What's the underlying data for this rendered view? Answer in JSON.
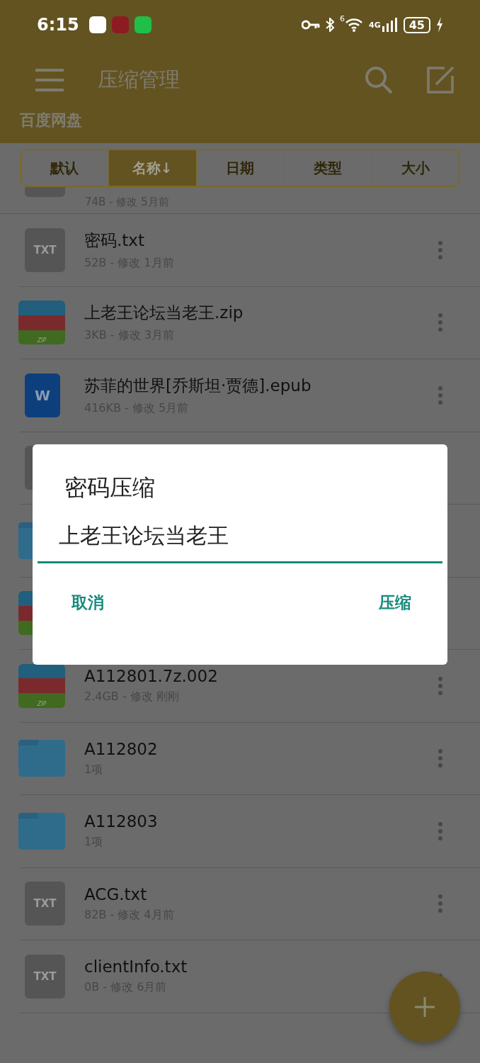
{
  "status_bar": {
    "time": "6:15",
    "wifi_label": "6",
    "network": "4G",
    "battery": "45"
  },
  "app_bar": {
    "title": "压缩管理"
  },
  "location": "百度网盘",
  "sort_tabs": [
    {
      "label": "默认",
      "selected": false
    },
    {
      "label": "名称↓",
      "selected": true
    },
    {
      "label": "日期",
      "selected": false
    },
    {
      "label": "类型",
      "selected": false
    },
    {
      "label": "大小",
      "selected": false
    }
  ],
  "partial_row": {
    "meta": "74B - 修改 5月前"
  },
  "files": [
    {
      "kind": "txt",
      "badge": "TXT",
      "name": "密码.txt",
      "meta": "52B - 修改 1月前",
      "menu_covered": false
    },
    {
      "kind": "zip",
      "badge": "ZIP",
      "name": "上老王论坛当老王.zip",
      "meta": "3KB - 修改 3月前",
      "menu_covered": false
    },
    {
      "kind": "epub",
      "badge": "W",
      "name": "苏菲的世界[乔斯坦·贾德].epub",
      "meta": "416KB - 修改 5月前",
      "menu_covered": false
    },
    {
      "kind": "txt"
    },
    {
      "kind": "folder"
    },
    {
      "kind": "zip"
    },
    {
      "kind": "zip",
      "badge": "ZIP",
      "name": "A112801.7z.002",
      "meta": "2.4GB - 修改 刚刚",
      "menu_covered": false
    },
    {
      "kind": "folder",
      "name": "A112802",
      "meta": "1项",
      "menu_covered": false
    },
    {
      "kind": "folder",
      "name": "A112803",
      "meta": "1项",
      "menu_covered": false
    },
    {
      "kind": "txt",
      "badge": "TXT",
      "name": "ACG.txt",
      "meta": "82B - 修改 4月前",
      "menu_covered": false
    },
    {
      "kind": "txt",
      "badge": "TXT",
      "name": "clientInfo.txt",
      "meta": "0B - 修改 6月前",
      "menu_covered": true
    }
  ],
  "dialog": {
    "title": "密码压缩",
    "value": "上老王论坛当老王",
    "buttons": [
      "取消",
      "压缩"
    ]
  }
}
